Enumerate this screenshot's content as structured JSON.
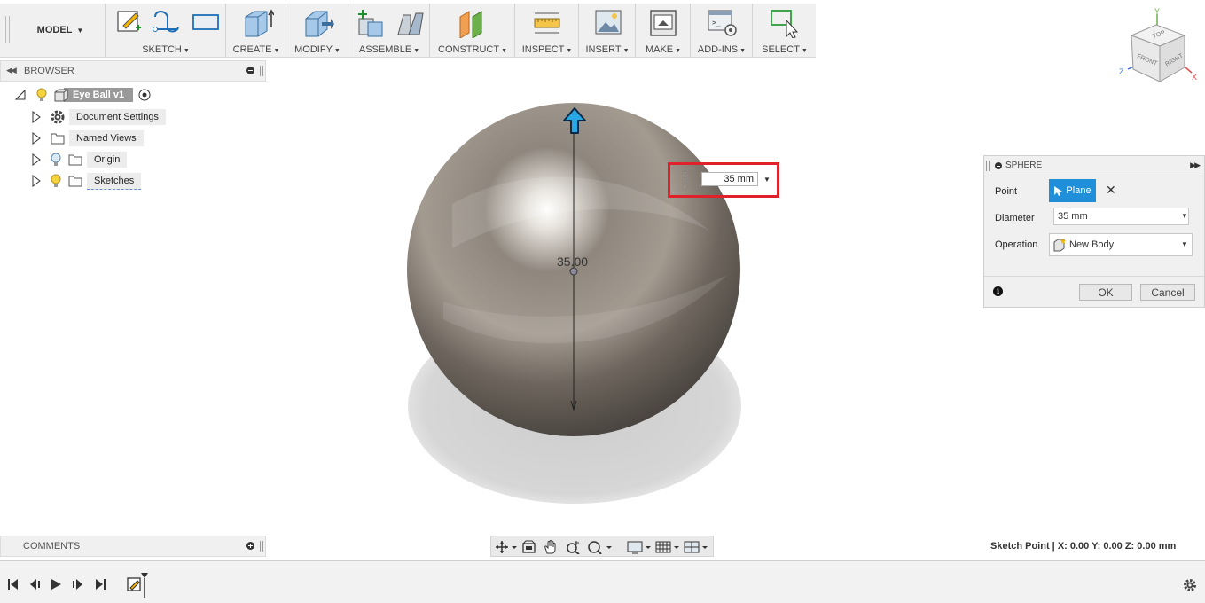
{
  "toolbar": {
    "workspace": "MODEL",
    "groups": [
      {
        "label": "SKETCH"
      },
      {
        "label": "CREATE"
      },
      {
        "label": "MODIFY"
      },
      {
        "label": "ASSEMBLE"
      },
      {
        "label": "CONSTRUCT"
      },
      {
        "label": "INSPECT"
      },
      {
        "label": "INSERT"
      },
      {
        "label": "MAKE"
      },
      {
        "label": "ADD-INS"
      },
      {
        "label": "SELECT"
      }
    ]
  },
  "browser": {
    "title": "BROWSER",
    "root": "Eye Ball v1",
    "items": [
      {
        "label": "Document Settings",
        "icon": "gear-icon"
      },
      {
        "label": "Named Views",
        "icon": "folder-icon"
      },
      {
        "label": "Origin",
        "icon": "folder-icon"
      },
      {
        "label": "Sketches",
        "icon": "folder-icon"
      }
    ]
  },
  "comments": {
    "title": "COMMENTS"
  },
  "viewport": {
    "dimension_label": "35.00",
    "dimension_input": "35 mm"
  },
  "sphere_dialog": {
    "title": "SPHERE",
    "point_label": "Point",
    "point_button": "Plane",
    "diameter_label": "Diameter",
    "diameter_value": "35 mm",
    "operation_label": "Operation",
    "operation_value": "New Body",
    "ok": "OK",
    "cancel": "Cancel"
  },
  "viewcube": {
    "top": "TOP",
    "front": "FRONT",
    "right": "RIGHT",
    "x": "X",
    "y": "Y",
    "z": "Z"
  },
  "status": "Sketch Point | X: 0.00 Y: 0.00 Z: 0.00 mm",
  "colors": {
    "accent": "#1e8fd8",
    "highlight": "#e0202a"
  }
}
